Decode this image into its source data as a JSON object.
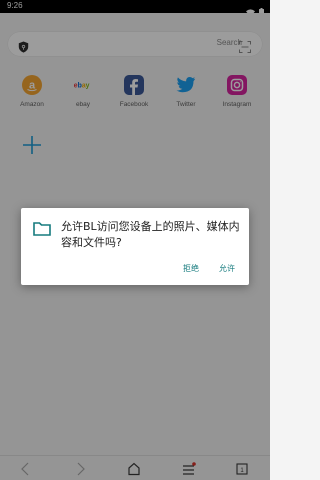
{
  "status_bar": {
    "time": "9:26"
  },
  "search_bar": {
    "placeholder": "Search"
  },
  "speed_dial": [
    {
      "label": "Amazon",
      "icon": "amazon-icon",
      "color": "#f5a631"
    },
    {
      "label": "ebay",
      "icon": "ebay-icon",
      "color": "#e53238"
    },
    {
      "label": "Facebook",
      "icon": "facebook-icon",
      "color": "#3b5998"
    },
    {
      "label": "Twitter",
      "icon": "twitter-icon",
      "color": "#1da1f2"
    },
    {
      "label": "Instagram",
      "icon": "instagram-icon",
      "color": "#d6249f"
    }
  ],
  "permission_dialog": {
    "message": "允许BL访问您设备上的照片、媒体内容和文件吗?",
    "deny_label": "拒绝",
    "allow_label": "允许",
    "accent_color": "#167b7e"
  }
}
